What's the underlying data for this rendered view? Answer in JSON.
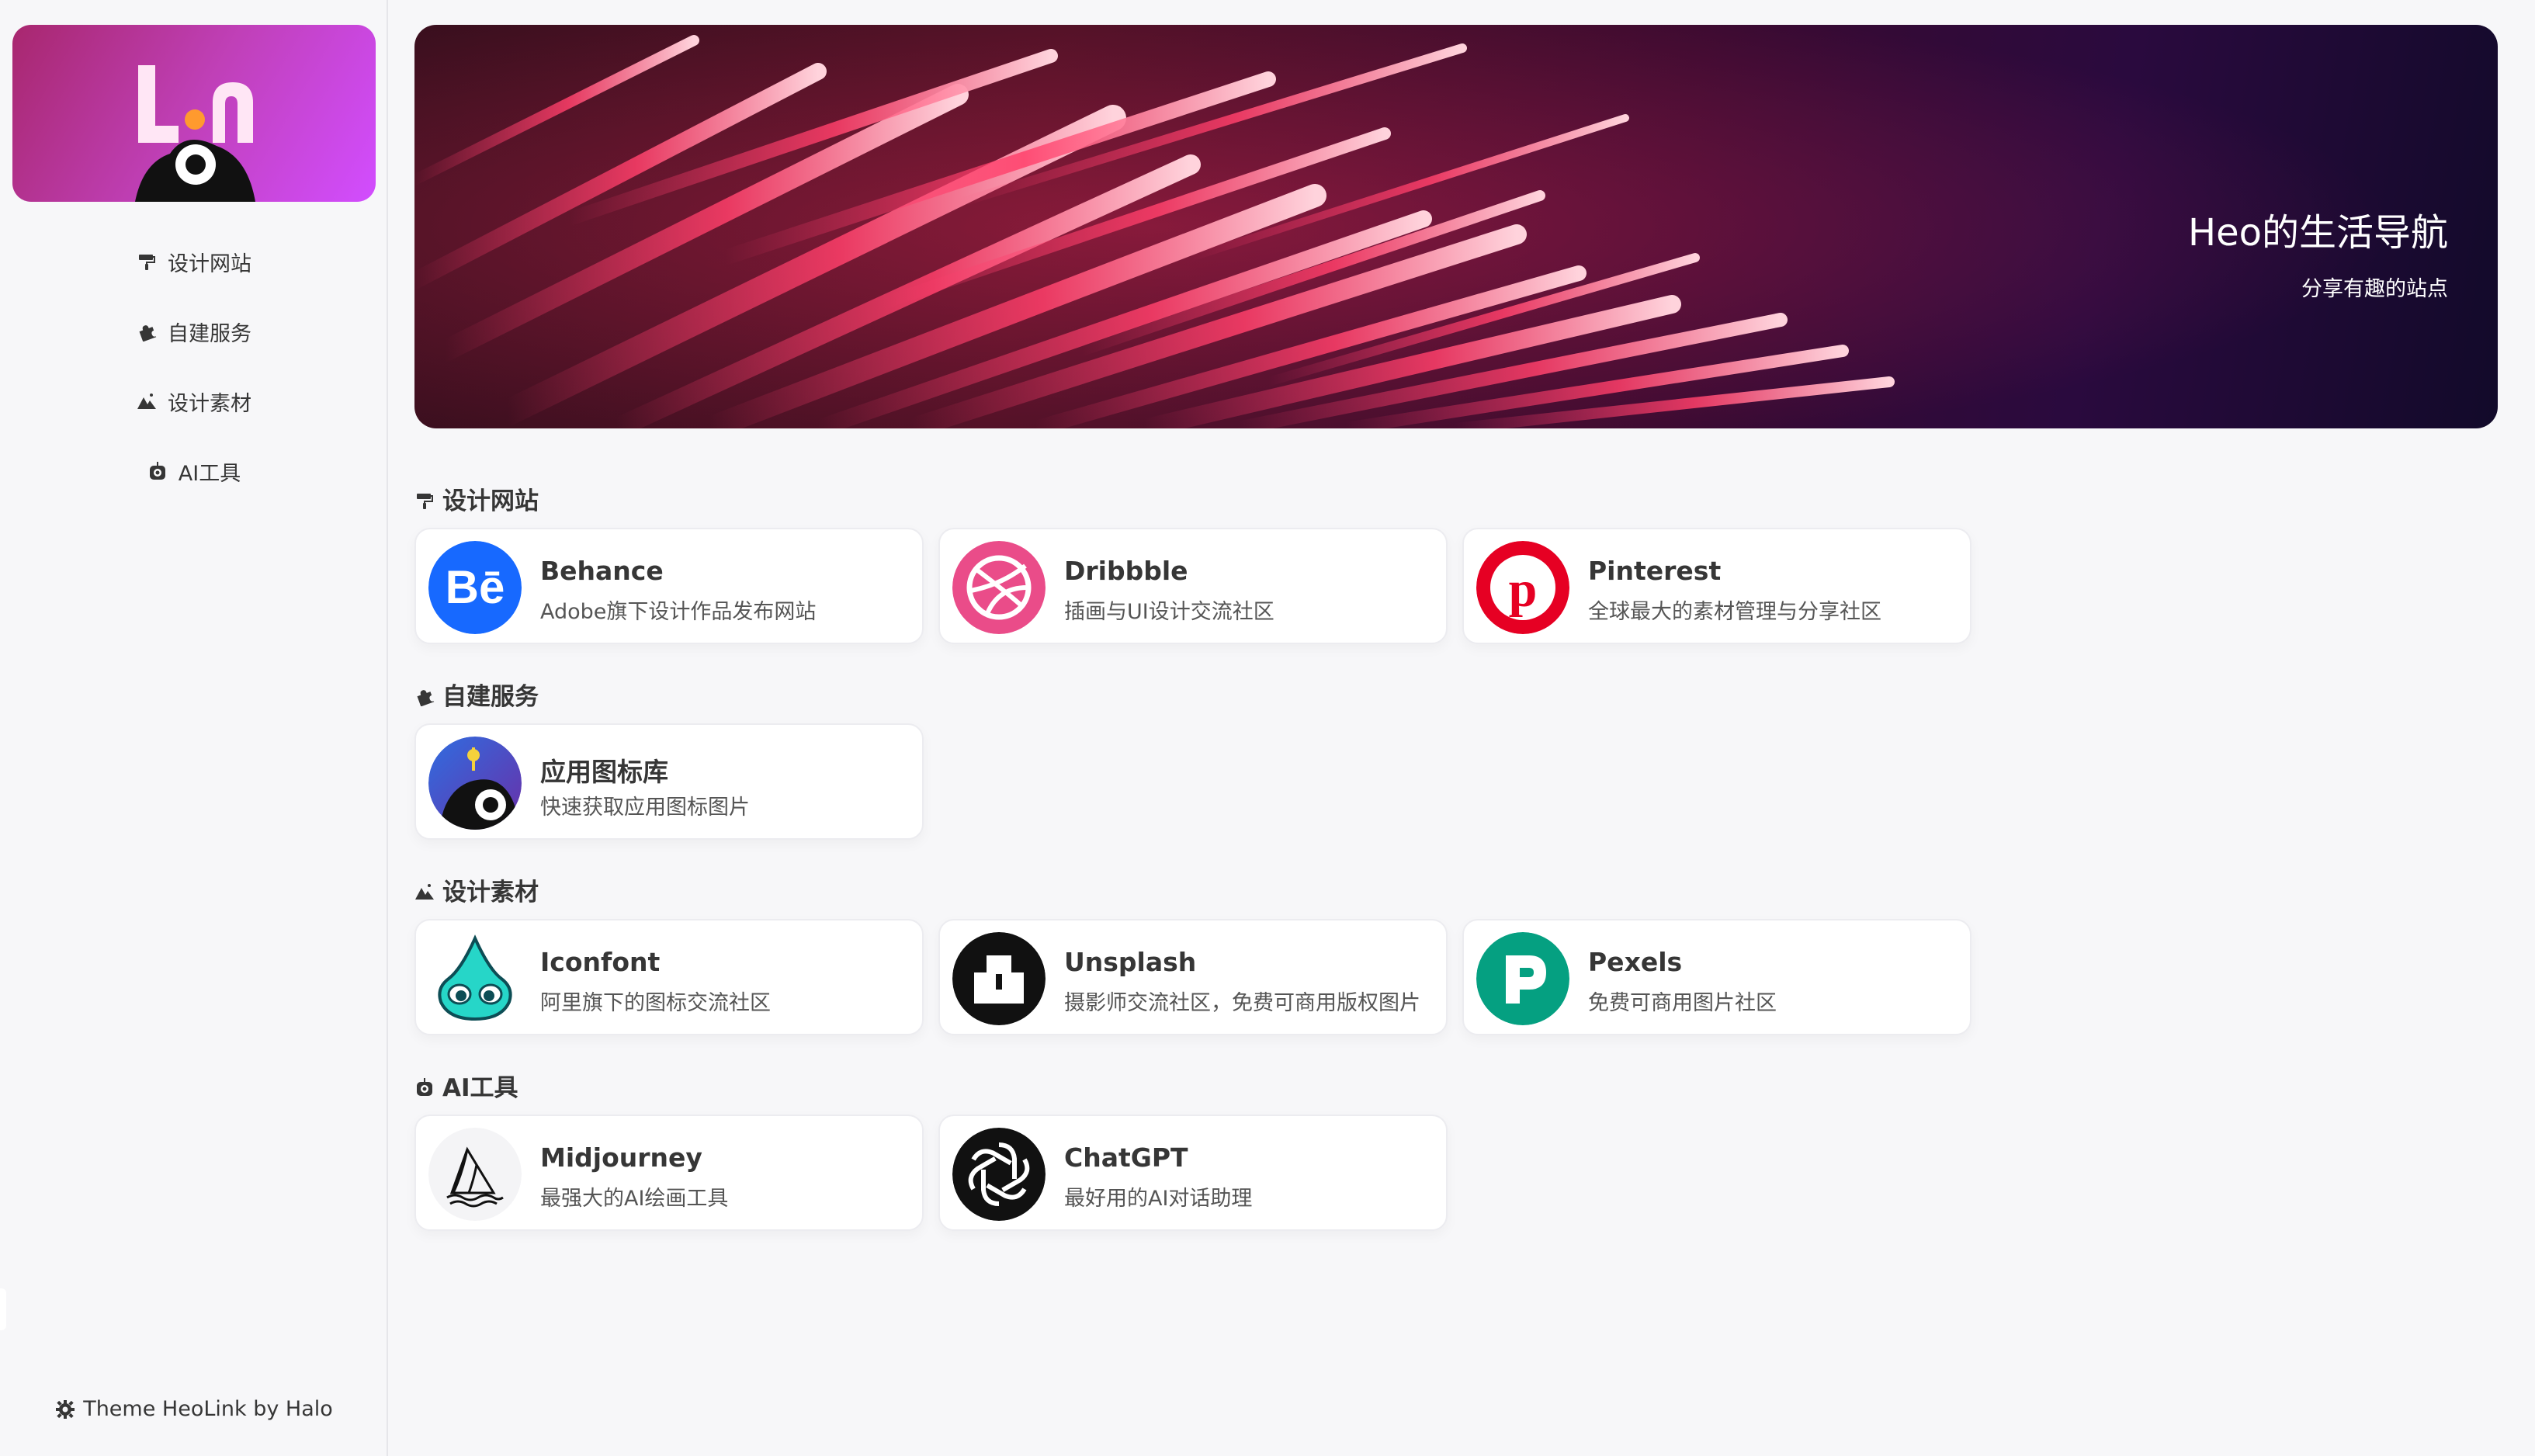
{
  "sidebar": {
    "nav": [
      {
        "label": "设计网站",
        "icon": "paint-roller-icon"
      },
      {
        "label": "自建服务",
        "icon": "puzzle-piece-icon"
      },
      {
        "label": "设计素材",
        "icon": "mountains-icon"
      },
      {
        "label": "AI工具",
        "icon": "robot-icon"
      }
    ],
    "footer": "Theme HeoLink by Halo"
  },
  "banner": {
    "title": "Heo的生活导航",
    "subtitle": "分享有趣的站点"
  },
  "sections": [
    {
      "title": "设计网站",
      "items": [
        {
          "name": "Behance",
          "desc": "Adobe旗下设计作品发布网站"
        },
        {
          "name": "Dribbble",
          "desc": "插画与UI设计交流社区"
        },
        {
          "name": "Pinterest",
          "desc": "全球最大的素材管理与分享社区"
        }
      ]
    },
    {
      "title": "自建服务",
      "items": [
        {
          "name": "应用图标库",
          "desc": "快速获取应用图标图片"
        }
      ]
    },
    {
      "title": "设计素材",
      "items": [
        {
          "name": "Iconfont",
          "desc": "阿里旗下的图标交流社区"
        },
        {
          "name": "Unsplash",
          "desc": "摄影师交流社区，免费可商用版权图片"
        },
        {
          "name": "Pexels",
          "desc": "免费可商用图片社区"
        }
      ]
    },
    {
      "title": "AI工具",
      "items": [
        {
          "name": "Midjourney",
          "desc": "最强大的AI绘画工具"
        },
        {
          "name": "ChatGPT",
          "desc": "最好用的AI对话助理"
        }
      ]
    }
  ],
  "colors": {
    "behance": "#1769ff",
    "dribbble": "#ea4c89",
    "pinterest": "#e60023",
    "pexels": "#05a081",
    "logo_gradient_start": "#a8276e",
    "logo_gradient_end": "#d24dff"
  }
}
